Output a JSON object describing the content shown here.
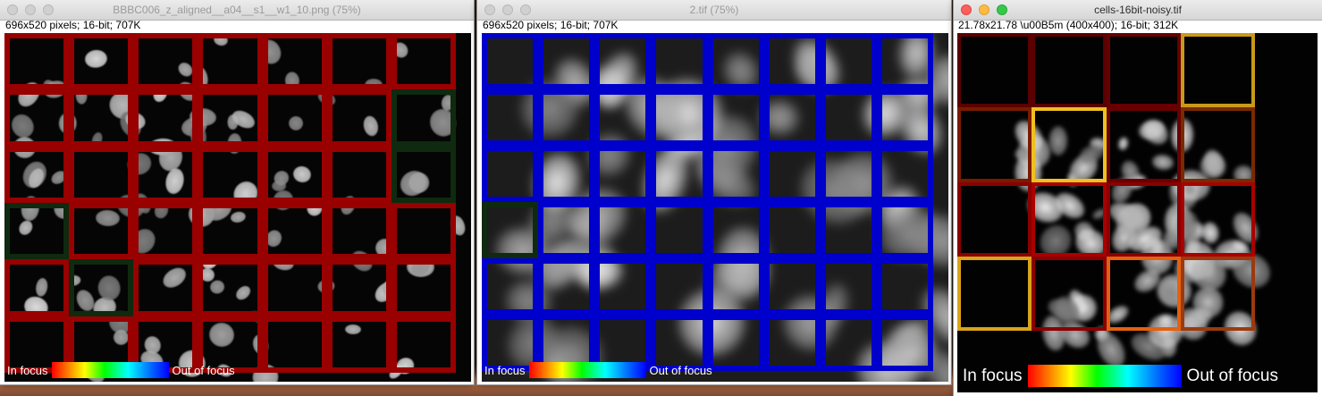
{
  "windows": [
    {
      "title": "BBBC006_z_aligned__a04__s1__w1_10.png (75%)",
      "info": "696x520 pixels; 16-bit; 707K",
      "legend": {
        "in_focus": "In focus",
        "out_of_focus": "Out of focus"
      },
      "tiles": [
        "#990000",
        "#990000",
        "#990000",
        "#990000",
        "#990000",
        "#990000",
        "#990000",
        "#990000",
        "#990000",
        "#990000",
        "#990000",
        "#990000",
        "#990000",
        "#0f2a0f",
        "#990000",
        "#990000",
        "#990000",
        "#990000",
        "#990000",
        "#990000",
        "#0f2a0f",
        "#0f2a0f",
        "#990000",
        "#990000",
        "#990000",
        "#990000",
        "#990000",
        "#990000",
        "#990000",
        "#0f2a0f",
        "#990000",
        "#990000",
        "#990000",
        "#990000",
        "#990000",
        "#990000",
        "#990000",
        "#990000",
        "#990000",
        "#990000",
        "#990000",
        "#990000"
      ]
    },
    {
      "title": "2.tif (75%)",
      "info": "696x520 pixels; 16-bit; 707K",
      "legend": {
        "in_focus": "In focus",
        "out_of_focus": "Out of focus"
      },
      "tiles": [
        "#0000cc",
        "#0000cc",
        "#0000cc",
        "#0000cc",
        "#0000cc",
        "#0000cc",
        "#0000cc",
        "#0000cc",
        "#0000cc",
        "#0000cc",
        "#0000cc",
        "#0000cc",
        "#0000cc",
        "#0000cc",
        "#0000cc",
        "#0000cc",
        "#0000cc",
        "#0000cc",
        "#0000cc",
        "#0000cc",
        "#0000cc",
        "#0000cc",
        "#0000cc",
        "#0000cc",
        "#0f2a0f",
        "#0000cc",
        "#0000cc",
        "#0000cc",
        "#0000cc",
        "#0000cc",
        "#0000cc",
        "#0000cc",
        "#0000cc",
        "#0000cc",
        "#0000cc",
        "#0000cc",
        "#0000cc",
        "#0000cc",
        "#0000cc",
        "#0000cc",
        "#0000cc",
        "#0000cc",
        "#0000cc",
        "#0000cc",
        "#0000cc",
        "#0000cc",
        "#0000cc",
        "#0000cc"
      ]
    },
    {
      "title": "cells-16bit-noisy.tif",
      "info": "21.78x21.78 \\u00B5m (400x400); 16-bit; 312K",
      "legend": {
        "in_focus": "In focus",
        "out_of_focus": "Out of focus"
      },
      "tiles": [
        "#5a0000",
        "#5a0000",
        "#660000",
        "#c89a1a",
        "#7a1a00",
        "#f0c020",
        "#6a0000",
        "#7a2a00",
        "#8a0000",
        "#aa0000",
        "#8a0000",
        "#aa0000",
        "#d8a418",
        "#8a0000",
        "#e46010",
        "#9a3a10"
      ]
    }
  ]
}
